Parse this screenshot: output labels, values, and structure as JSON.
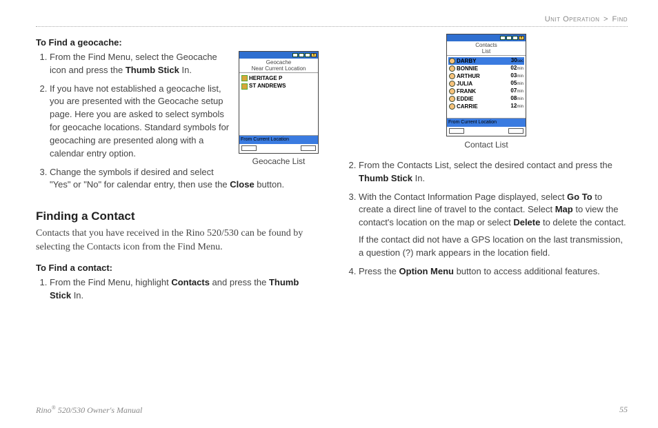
{
  "breadcrumb": {
    "section": "Unit Operation",
    "sep": ">",
    "sub": "Find"
  },
  "left": {
    "subhead1": "To Find a geocache:",
    "steps1": [
      {
        "pre": "From the Find Menu, select the Geocache icon and press the ",
        "bold": "Thumb Stick",
        "post": " In."
      },
      {
        "text": "If you have not established a geocache list, you are presented with the Geocache setup page. Here you are asked to select symbols for geocache locations. Standard symbols for geocaching are presented along with a calendar entry option."
      },
      {
        "text_html": "Change the symbols if desired and select \"Yes\" or \"No\" for calendar entry, then use the ",
        "bold": "Close",
        "post": " button."
      }
    ],
    "headline": "Finding a Contact",
    "intro": "Contacts that you have received in the Rino 520/530 can be found by selecting the Contacts icon from the Find Menu.",
    "subhead2": "To Find a contact:",
    "steps2_pre": "From the Find Menu, highlight ",
    "steps2_bold1": "Contacts",
    "steps2_mid": " and press the ",
    "steps2_bold2": "Thumb Stick",
    "steps2_post": " In."
  },
  "geocache_fig": {
    "title_line1": "Geocache",
    "title_line2": "Near Current Location",
    "rows": [
      "HERITAGE P",
      "ST ANDREWS"
    ],
    "bluebar": "From Current Location",
    "caption": "Geocache List"
  },
  "contact_fig": {
    "title_line1": "Contacts",
    "title_line2": "List",
    "rows": [
      {
        "name": "DARBY",
        "dist": "30",
        "unit": "sec",
        "selected": true
      },
      {
        "name": "BONNIE",
        "dist": "02",
        "unit": "min"
      },
      {
        "name": "ARTHUR",
        "dist": "03",
        "unit": "min"
      },
      {
        "name": "JULIA",
        "dist": "05",
        "unit": "min"
      },
      {
        "name": "FRANK",
        "dist": "07",
        "unit": "min"
      },
      {
        "name": "EDDIE",
        "dist": "08",
        "unit": "min"
      },
      {
        "name": "CARRIE",
        "dist": "12",
        "unit": "min"
      }
    ],
    "bluebar": "From Current Location",
    "caption": "Contact List"
  },
  "right": {
    "step2_pre": "From the Contacts List, select the desired contact and press the ",
    "step2_bold": "Thumb Stick",
    "step2_post": " In.",
    "step3_a": "With the Contact Information Page displayed, select ",
    "step3_b1": "Go To",
    "step3_c": " to create a direct line of travel to the contact. Select ",
    "step3_b2": "Map",
    "step3_d": " to view the contact's location on the map or select ",
    "step3_b3": "Delete",
    "step3_e": " to delete the contact.",
    "step3_para2": "If the contact did not have a GPS location on the last transmission, a question (?) mark appears in the location field.",
    "step4_pre": "Press the ",
    "step4_bold": "Option Menu",
    "step4_post": " button to access additional features."
  },
  "footer": {
    "left_pre": "Rino",
    "left_sup": "®",
    "left_post": " 520/530 Owner's Manual",
    "page": "55"
  }
}
